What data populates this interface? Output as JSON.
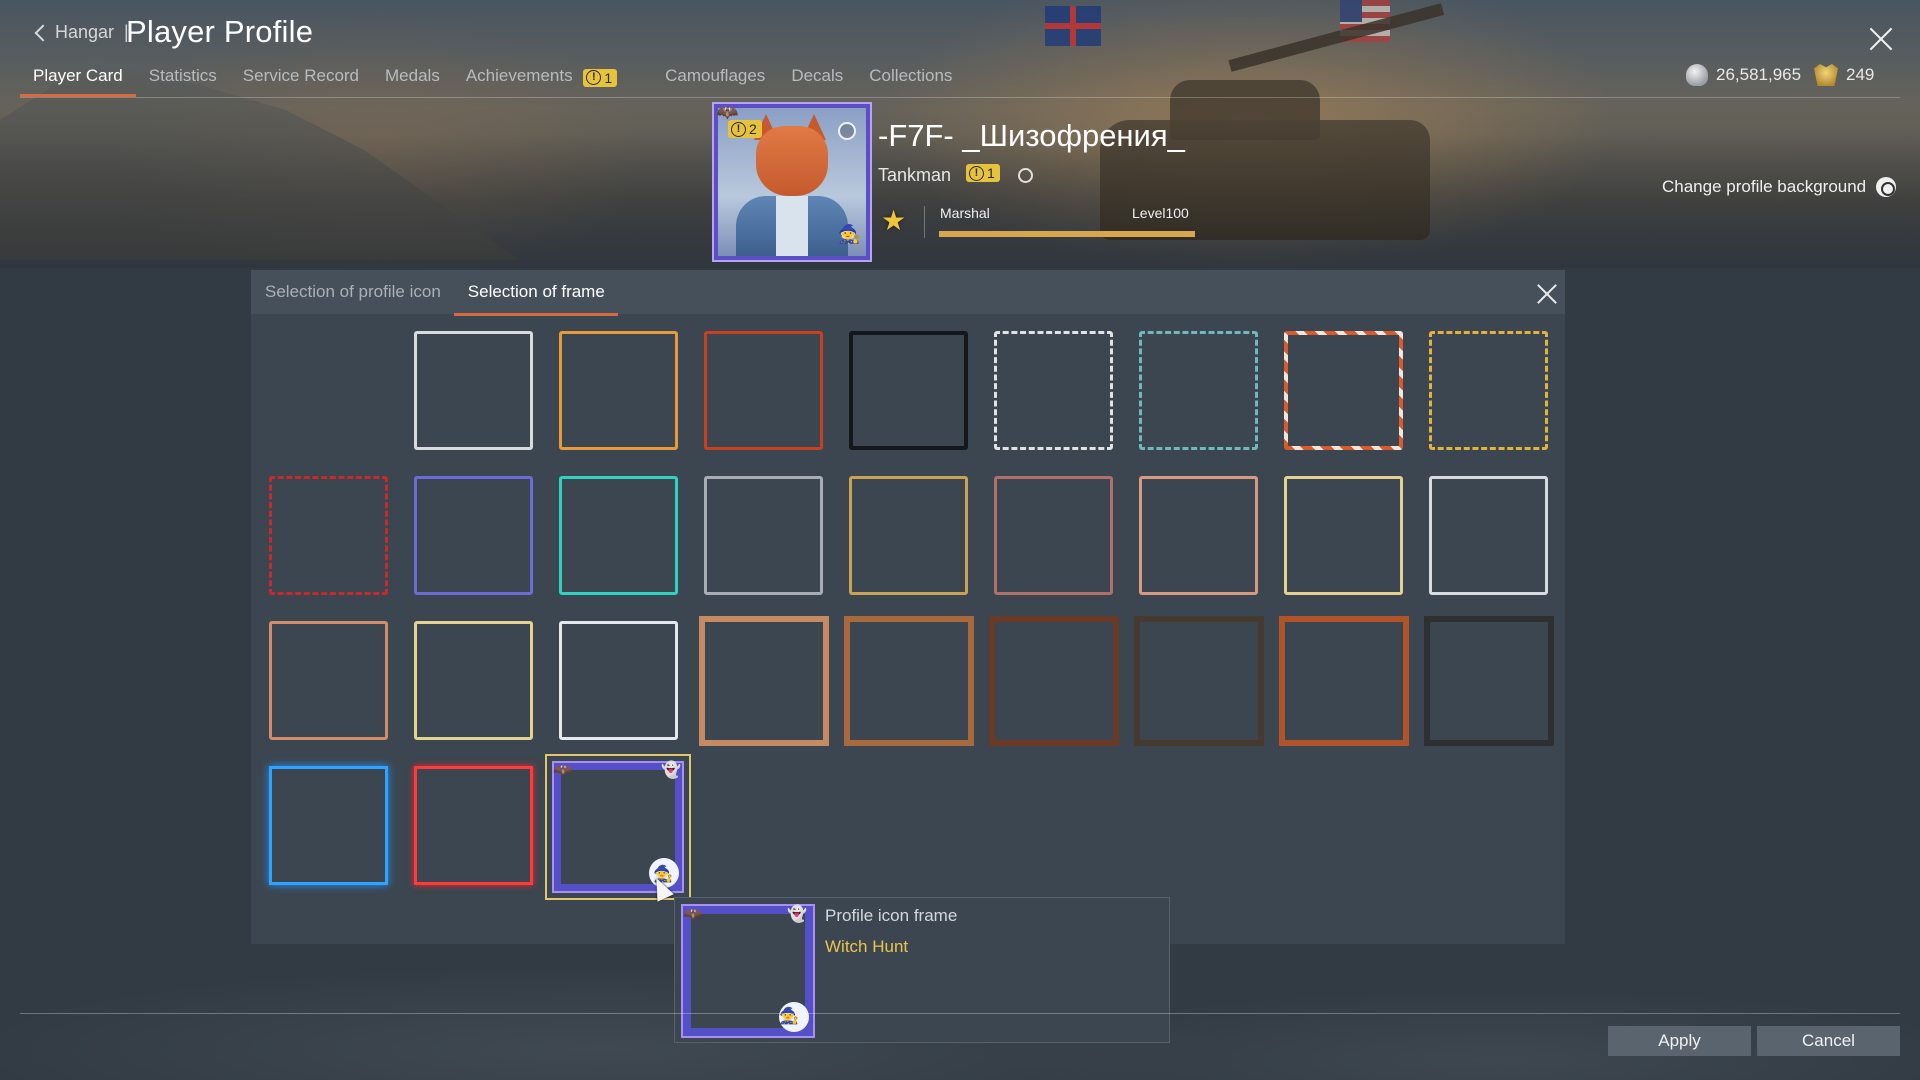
{
  "header": {
    "back_label": "Hangar",
    "separator": "|",
    "title": "Player Profile"
  },
  "tabs": [
    {
      "label": "Player Card",
      "active": true
    },
    {
      "label": "Statistics"
    },
    {
      "label": "Service Record"
    },
    {
      "label": "Medals"
    },
    {
      "label": "Achievements",
      "badge": "1"
    },
    {
      "label": "Camouflages"
    },
    {
      "label": "Decals"
    },
    {
      "label": "Collections"
    }
  ],
  "currency": {
    "silver": "26,581,965",
    "gold": "249"
  },
  "profile": {
    "name": "-F7F- _Шизофрения_",
    "title": "Tankman",
    "title_badge": "1",
    "avatar_badge": "2",
    "rank": "Marshal",
    "level": "Level100",
    "level_progress": 1.0
  },
  "change_background_label": "Change profile background",
  "dialog": {
    "tabs": [
      {
        "label": "Selection of profile icon"
      },
      {
        "label": "Selection of frame",
        "active": true
      }
    ],
    "frames": [
      "white",
      "orange",
      "red",
      "black",
      "dash-white",
      "dash-teal",
      "dash-redwhite",
      "dash-gold",
      "dash-red",
      "blue",
      "teal",
      "silver",
      "gold-thin",
      "rose",
      "peach",
      "cream",
      "platinum",
      "copper",
      "paleyellow",
      "chrome",
      "bronze-lt",
      "bronze",
      "bronze-dk",
      "dark-bronze",
      "copper-md",
      "gunmetal",
      "neon-blue",
      "neon-red",
      "witch-hunt"
    ],
    "selected_frame": "witch-hunt"
  },
  "tooltip": {
    "heading": "Profile icon frame",
    "name": "Witch Hunt"
  },
  "buttons": {
    "apply": "Apply",
    "cancel": "Cancel"
  },
  "colors": {
    "accent": "#d96a3e",
    "badge": "#e7c23b",
    "highlight_text": "#e9c54a"
  }
}
